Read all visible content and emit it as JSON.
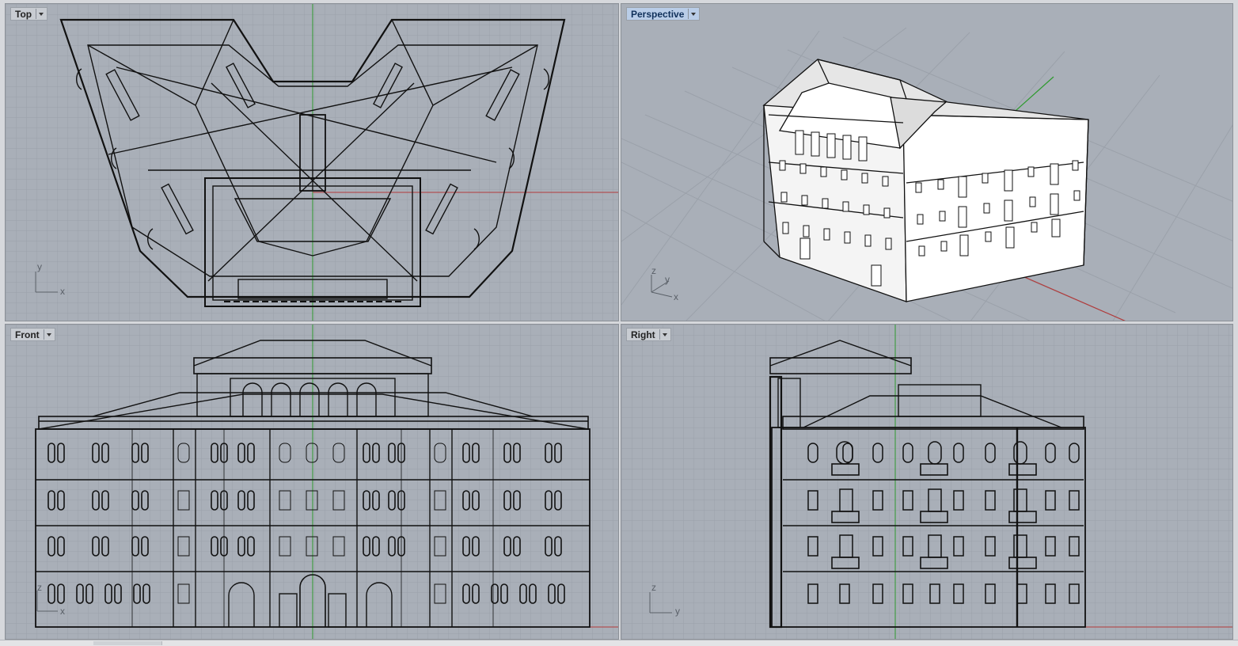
{
  "viewports": {
    "top": {
      "label": "Top",
      "axes": {
        "a": "y",
        "b": "x"
      }
    },
    "perspective": {
      "label": "Perspective",
      "axes": {
        "a": "z",
        "b": "y",
        "c": "x"
      }
    },
    "front": {
      "label": "Front",
      "axes": {
        "a": "z",
        "b": "x"
      }
    },
    "right": {
      "label": "Right",
      "axes": {
        "a": "z",
        "b": "y"
      }
    }
  },
  "colors": {
    "viewport_bg": "#a9afb8",
    "grid": "#9ba1aa",
    "grid_major": "#8f959e",
    "x_axis": "#b23a3a",
    "y_axis": "#2e9a2e",
    "active_label": "#b9cde8",
    "wire": "#111111"
  },
  "icons": {
    "dropdown": "chevron-down-icon"
  }
}
